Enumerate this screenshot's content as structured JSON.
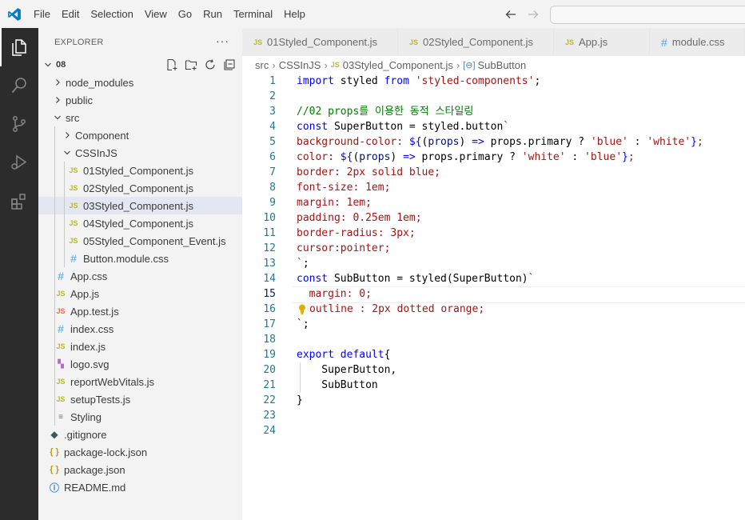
{
  "titlebar": {
    "menu": [
      "File",
      "Edit",
      "Selection",
      "View",
      "Go",
      "Run",
      "Terminal",
      "Help"
    ]
  },
  "sidebar": {
    "title": "EXPLORER",
    "more": "···",
    "root": "08",
    "items": [
      {
        "label": "node_modules",
        "kind": "folder",
        "expanded": false
      },
      {
        "label": "public",
        "kind": "folder",
        "expanded": false
      },
      {
        "label": "src",
        "kind": "folder",
        "expanded": true
      },
      {
        "label": "Component",
        "kind": "folder",
        "expanded": false
      },
      {
        "label": "CSSInJS",
        "kind": "folder",
        "expanded": true
      },
      {
        "label": "01Styled_Component.js",
        "kind": "js"
      },
      {
        "label": "02Styled_Component.js",
        "kind": "js"
      },
      {
        "label": "03Styled_Component.js",
        "kind": "js",
        "selected": true
      },
      {
        "label": "04Styled_Component.js",
        "kind": "js"
      },
      {
        "label": "05Styled_Component_Event.js",
        "kind": "js"
      },
      {
        "label": "Button.module.css",
        "kind": "css"
      },
      {
        "label": "App.css",
        "kind": "css"
      },
      {
        "label": "App.js",
        "kind": "js"
      },
      {
        "label": "App.test.js",
        "kind": "jsred"
      },
      {
        "label": "index.css",
        "kind": "css"
      },
      {
        "label": "index.js",
        "kind": "js"
      },
      {
        "label": "logo.svg",
        "kind": "svg"
      },
      {
        "label": "reportWebVitals.js",
        "kind": "js"
      },
      {
        "label": "setupTests.js",
        "kind": "js"
      },
      {
        "label": "Styling",
        "kind": "txt"
      },
      {
        "label": ".gitignore",
        "kind": "git"
      },
      {
        "label": "package-lock.json",
        "kind": "json"
      },
      {
        "label": "package.json",
        "kind": "json"
      },
      {
        "label": "README.md",
        "kind": "info"
      }
    ]
  },
  "tabs": [
    {
      "label": "01Styled_Component.js",
      "icon": "JS"
    },
    {
      "label": "02Styled_Component.js",
      "icon": "JS"
    },
    {
      "label": "App.js",
      "icon": "JS"
    },
    {
      "label": "module.css",
      "icon": "#"
    }
  ],
  "breadcrumb": {
    "parts": [
      "src",
      "CSSInJS",
      "03Styled_Component.js",
      "SubButton"
    ]
  },
  "editor": {
    "line_numbers": [
      "1",
      "2",
      "3",
      "4",
      "5",
      "6",
      "7",
      "8",
      "9",
      "10",
      "11",
      "12",
      "13",
      "14",
      "15",
      "16",
      "17",
      "18",
      "19",
      "20",
      "21",
      "22",
      "23",
      "24"
    ],
    "lines": [
      [
        [
          "kw",
          "import"
        ],
        [
          "plain",
          " styled "
        ],
        [
          "kw",
          "from"
        ],
        [
          "plain",
          " "
        ],
        [
          "st",
          "'styled-components'"
        ],
        [
          "plain",
          ";"
        ]
      ],
      [],
      [
        [
          "cm",
          "//02 props를 이용한 동적 스타일링"
        ]
      ],
      [
        [
          "kw",
          "const"
        ],
        [
          "plain",
          " SuperButton = styled.button"
        ],
        [
          "st",
          "`"
        ]
      ],
      [
        [
          "st",
          "background-color: "
        ],
        [
          "kw",
          "${"
        ],
        [
          "plain",
          "("
        ],
        [
          "vb",
          "props"
        ],
        [
          "plain",
          ") "
        ],
        [
          "kw",
          "=>"
        ],
        [
          "plain",
          " props.primary ? "
        ],
        [
          "st",
          "'blue'"
        ],
        [
          "plain",
          " : "
        ],
        [
          "st",
          "'white'"
        ],
        [
          "kw",
          "}"
        ],
        [
          "st",
          ";"
        ]
      ],
      [
        [
          "st",
          "color: "
        ],
        [
          "kw",
          "${"
        ],
        [
          "plain",
          "("
        ],
        [
          "vb",
          "props"
        ],
        [
          "plain",
          ") "
        ],
        [
          "kw",
          "=>"
        ],
        [
          "plain",
          " props.primary ? "
        ],
        [
          "st",
          "'white'"
        ],
        [
          "plain",
          " : "
        ],
        [
          "st",
          "'blue'"
        ],
        [
          "kw",
          "}"
        ],
        [
          "st",
          ";"
        ]
      ],
      [
        [
          "st",
          "border: 2px solid blue;"
        ]
      ],
      [
        [
          "st",
          "font-size: 1em;"
        ]
      ],
      [
        [
          "st",
          "margin: 1em;"
        ]
      ],
      [
        [
          "st",
          "padding: 0.25em 1em;"
        ]
      ],
      [
        [
          "st",
          "border-radius: 3px;"
        ]
      ],
      [
        [
          "st",
          "cursor:pointer;"
        ]
      ],
      [
        [
          "st",
          "`"
        ],
        [
          "plain",
          ";"
        ]
      ],
      [
        [
          "kw",
          "const"
        ],
        [
          "plain",
          " SubButton = styled(SuperButton)"
        ],
        [
          "st",
          "`"
        ]
      ],
      [
        [
          "st",
          "  margin: 0;"
        ]
      ],
      [
        [
          "st",
          "outline : 2px dotted orange;"
        ]
      ],
      [
        [
          "st",
          "`"
        ],
        [
          "plain",
          ";"
        ]
      ],
      [],
      [
        [
          "kw",
          "export default"
        ],
        [
          "plain",
          "{"
        ]
      ],
      [
        [
          "plain",
          "    SuperButton,"
        ]
      ],
      [
        [
          "plain",
          "    SubButton"
        ]
      ],
      [
        [
          "plain",
          "}"
        ]
      ],
      [],
      []
    ]
  },
  "colors": {
    "activitybar": "#2c2c2c",
    "sidebar": "#f3f3f3",
    "keyword": "#0000ff",
    "string": "#a31515",
    "comment": "#008000",
    "vscode_blue": "#007acc"
  }
}
